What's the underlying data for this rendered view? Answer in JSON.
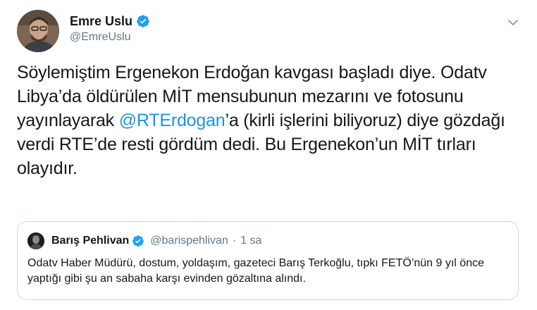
{
  "author": {
    "display_name": "Emre Uslu",
    "handle": "@EmreUslu",
    "verified": true,
    "avatar_icon": "user-avatar-photo"
  },
  "tweet": {
    "text_before_mention": "Söylemiştim Ergenekon Erdoğan kavgası başladı diye. Odatv Libya’da öldürülen MİT mensubunun mezarını ve fotosunu yayınlayarak ",
    "mention": "@RTErdogan",
    "text_after_mention": "’a (kirli işlerini biliyoruz) diye gözdağı verdi RTE’de resti gördüm dedi. Bu Ergenekon’un MİT tırları olayıdır."
  },
  "quoted_tweet": {
    "display_name": "Barış Pehlivan",
    "handle": "@barispehlivan",
    "separator": "·",
    "time": "1 sa",
    "verified": true,
    "text": "Odatv Haber Müdürü, dostum, yoldaşım, gazeteci Barış Terkoğlu, tıpkı FETÖ’nün 9 yıl önce yaptığı gibi şu an sabaha karşı evinden gözaltına alındı."
  },
  "colors": {
    "link": "#1b95e0",
    "verified": "#1da1f2",
    "secondary_text": "#657786",
    "border": "#ccd6dd"
  }
}
